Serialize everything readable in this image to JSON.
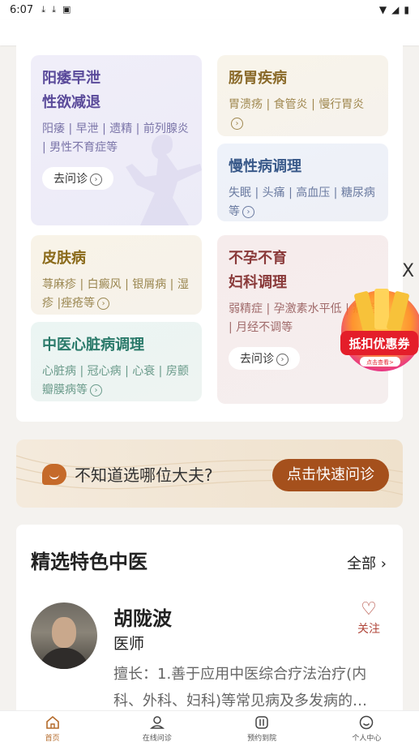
{
  "status_bar": {
    "time": "6:07",
    "icons": [
      "download-icon",
      "download-icon",
      "a-icon"
    ],
    "right_icons": [
      "wifi-icon",
      "signal-icon",
      "battery-icon"
    ]
  },
  "categories": [
    {
      "title_line1": "阳痿早泄",
      "title_line2": "性欲减退",
      "desc": "阳痿 | 早泄 | 遗精 | 前列腺炎 | 男性不育症等",
      "ask": "去问诊"
    },
    {
      "title_line1": "肠胃疾病",
      "desc": "胃溃疡 | 食管炎 | 慢行胃炎"
    },
    {
      "title_line1": "慢性病调理",
      "desc": "失眠 | 头痛 | 高血压 | 糖尿病等"
    },
    {
      "title_line1": "皮肤病",
      "desc": "荨麻疹 | 白癜风 | 银屑病 | 湿疹 |痤疮等"
    },
    {
      "title_line1": "不孕不育",
      "title_line2": "妇科调理",
      "desc": "弱精症 | 孕激素水平低 | 痛经 | 月经不调等",
      "ask": "去问诊"
    },
    {
      "title_line1": "中医心脏病调理",
      "desc": "心脏病 | 冠心病 | 心衰 | 房颤瓣膜病等"
    }
  ],
  "banner": {
    "text": "不知道选哪位大夫?",
    "button": "点击快速问诊"
  },
  "coupon": {
    "title": "抵扣优惠券",
    "subtitle": "点击查看>",
    "close": "X"
  },
  "doctors_section": {
    "heading": "精选特色中医",
    "all_label": "全部",
    "doctor": {
      "name": "胡陇波",
      "title": "医师",
      "follow": "关注",
      "desc": "擅长：1.善于应用中医综合疗法治疗(内科、外科、妇科)等常见病及多发病的…"
    }
  },
  "tabs": [
    {
      "label": "首页",
      "icon": "home-icon",
      "active": true
    },
    {
      "label": "在线问诊",
      "icon": "consult-icon",
      "active": false
    },
    {
      "label": "预约到院",
      "icon": "booking-icon",
      "active": false
    },
    {
      "label": "个人中心",
      "icon": "profile-icon",
      "active": false
    }
  ],
  "colors": {
    "accent": "#a5501c",
    "active_tab": "#b46a2a"
  }
}
